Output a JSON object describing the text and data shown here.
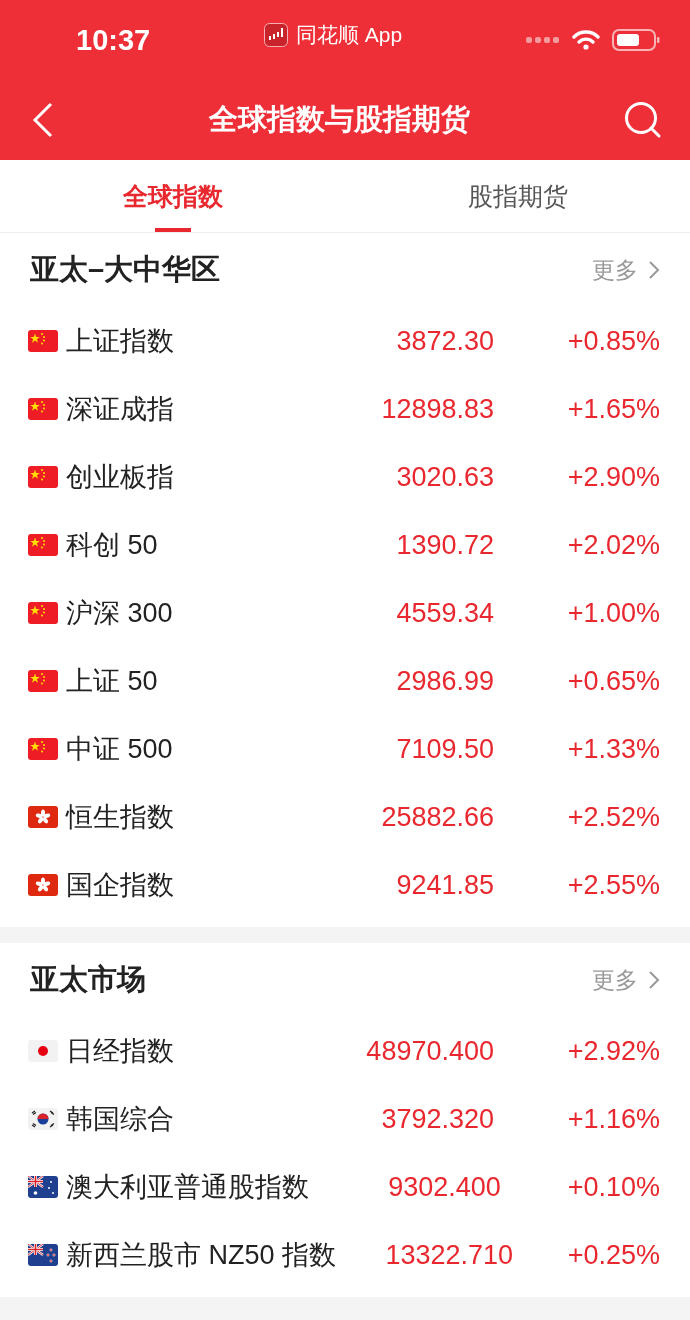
{
  "status_bar": {
    "time": "10:37",
    "app": "同花顺 App"
  },
  "nav": {
    "title": "全球指数与股指期货"
  },
  "tabs": [
    {
      "label": "全球指数",
      "selected": true
    },
    {
      "label": "股指期货",
      "selected": false
    }
  ],
  "sections": [
    {
      "title": "亚太–大中华区",
      "more": "更多",
      "rows": [
        {
          "kind": "cn",
          "name": "上证指数",
          "value": "3872.30",
          "change": "+0.85%"
        },
        {
          "kind": "cn",
          "name": "深证成指",
          "value": "12898.83",
          "change": "+1.65%"
        },
        {
          "kind": "cn",
          "name": "创业板指",
          "value": "3020.63",
          "change": "+2.90%"
        },
        {
          "kind": "cn",
          "name": "科创 50",
          "value": "1390.72",
          "change": "+2.02%"
        },
        {
          "kind": "cn",
          "name": "沪深 300",
          "value": "4559.34",
          "change": "+1.00%"
        },
        {
          "kind": "cn",
          "name": "上证 50",
          "value": "2986.99",
          "change": "+0.65%"
        },
        {
          "kind": "cn",
          "name": "中证 500",
          "value": "7109.50",
          "change": "+1.33%"
        },
        {
          "kind": "hk",
          "name": "恒生指数",
          "value": "25882.66",
          "change": "+2.52%"
        },
        {
          "kind": "hk",
          "name": "国企指数",
          "value": "9241.85",
          "change": "+2.55%"
        }
      ]
    },
    {
      "title": "亚太市场",
      "more": "更多",
      "rows": [
        {
          "kind": "jp",
          "name": "日经指数",
          "value": "48970.400",
          "change": "+2.92%"
        },
        {
          "kind": "kr",
          "name": "韩国综合",
          "value": "3792.320",
          "change": "+1.16%"
        },
        {
          "kind": "au",
          "name": "澳大利亚普通股指数",
          "value": "9302.400",
          "change": "+0.10%"
        },
        {
          "kind": "nz",
          "name": "新西兰股市 NZ50 指数",
          "value": "13322.710",
          "change": "+0.25%"
        }
      ]
    }
  ]
}
